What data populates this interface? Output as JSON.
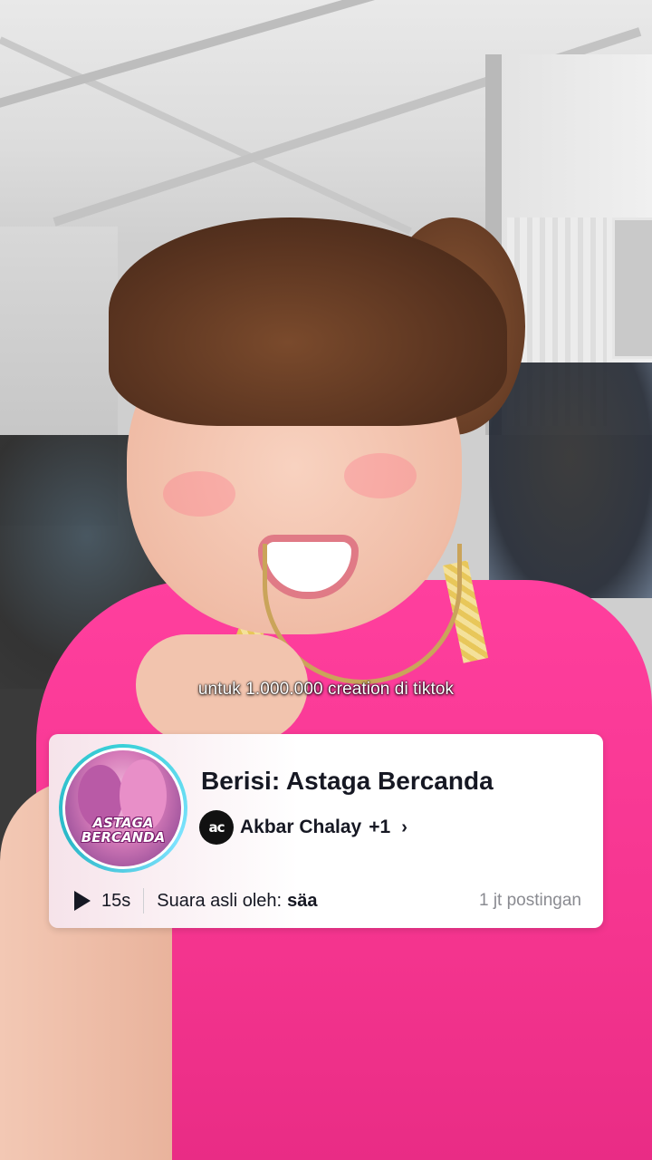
{
  "caption": "untuk 1.000.000 creation di tiktok",
  "sound_card": {
    "cover_text": "ASTAGA BERCANDA",
    "title": "Berisi: Astaga Bercanda",
    "artist": {
      "logo_text": "ac",
      "name": "Akbar Chalay",
      "more": "+1",
      "chevron_icon": "chevron-right-icon"
    },
    "play_icon": "play-icon",
    "duration": "15s",
    "original_sound_label": "Suara asli oleh:",
    "original_sound_by": "säa",
    "post_count": "1 jt postingan"
  },
  "colors": {
    "shirt": "#ff3f9e",
    "card_bg": "#ffffff",
    "cover_ring": "#3ad0d8",
    "muted_text": "#8a8b91"
  }
}
